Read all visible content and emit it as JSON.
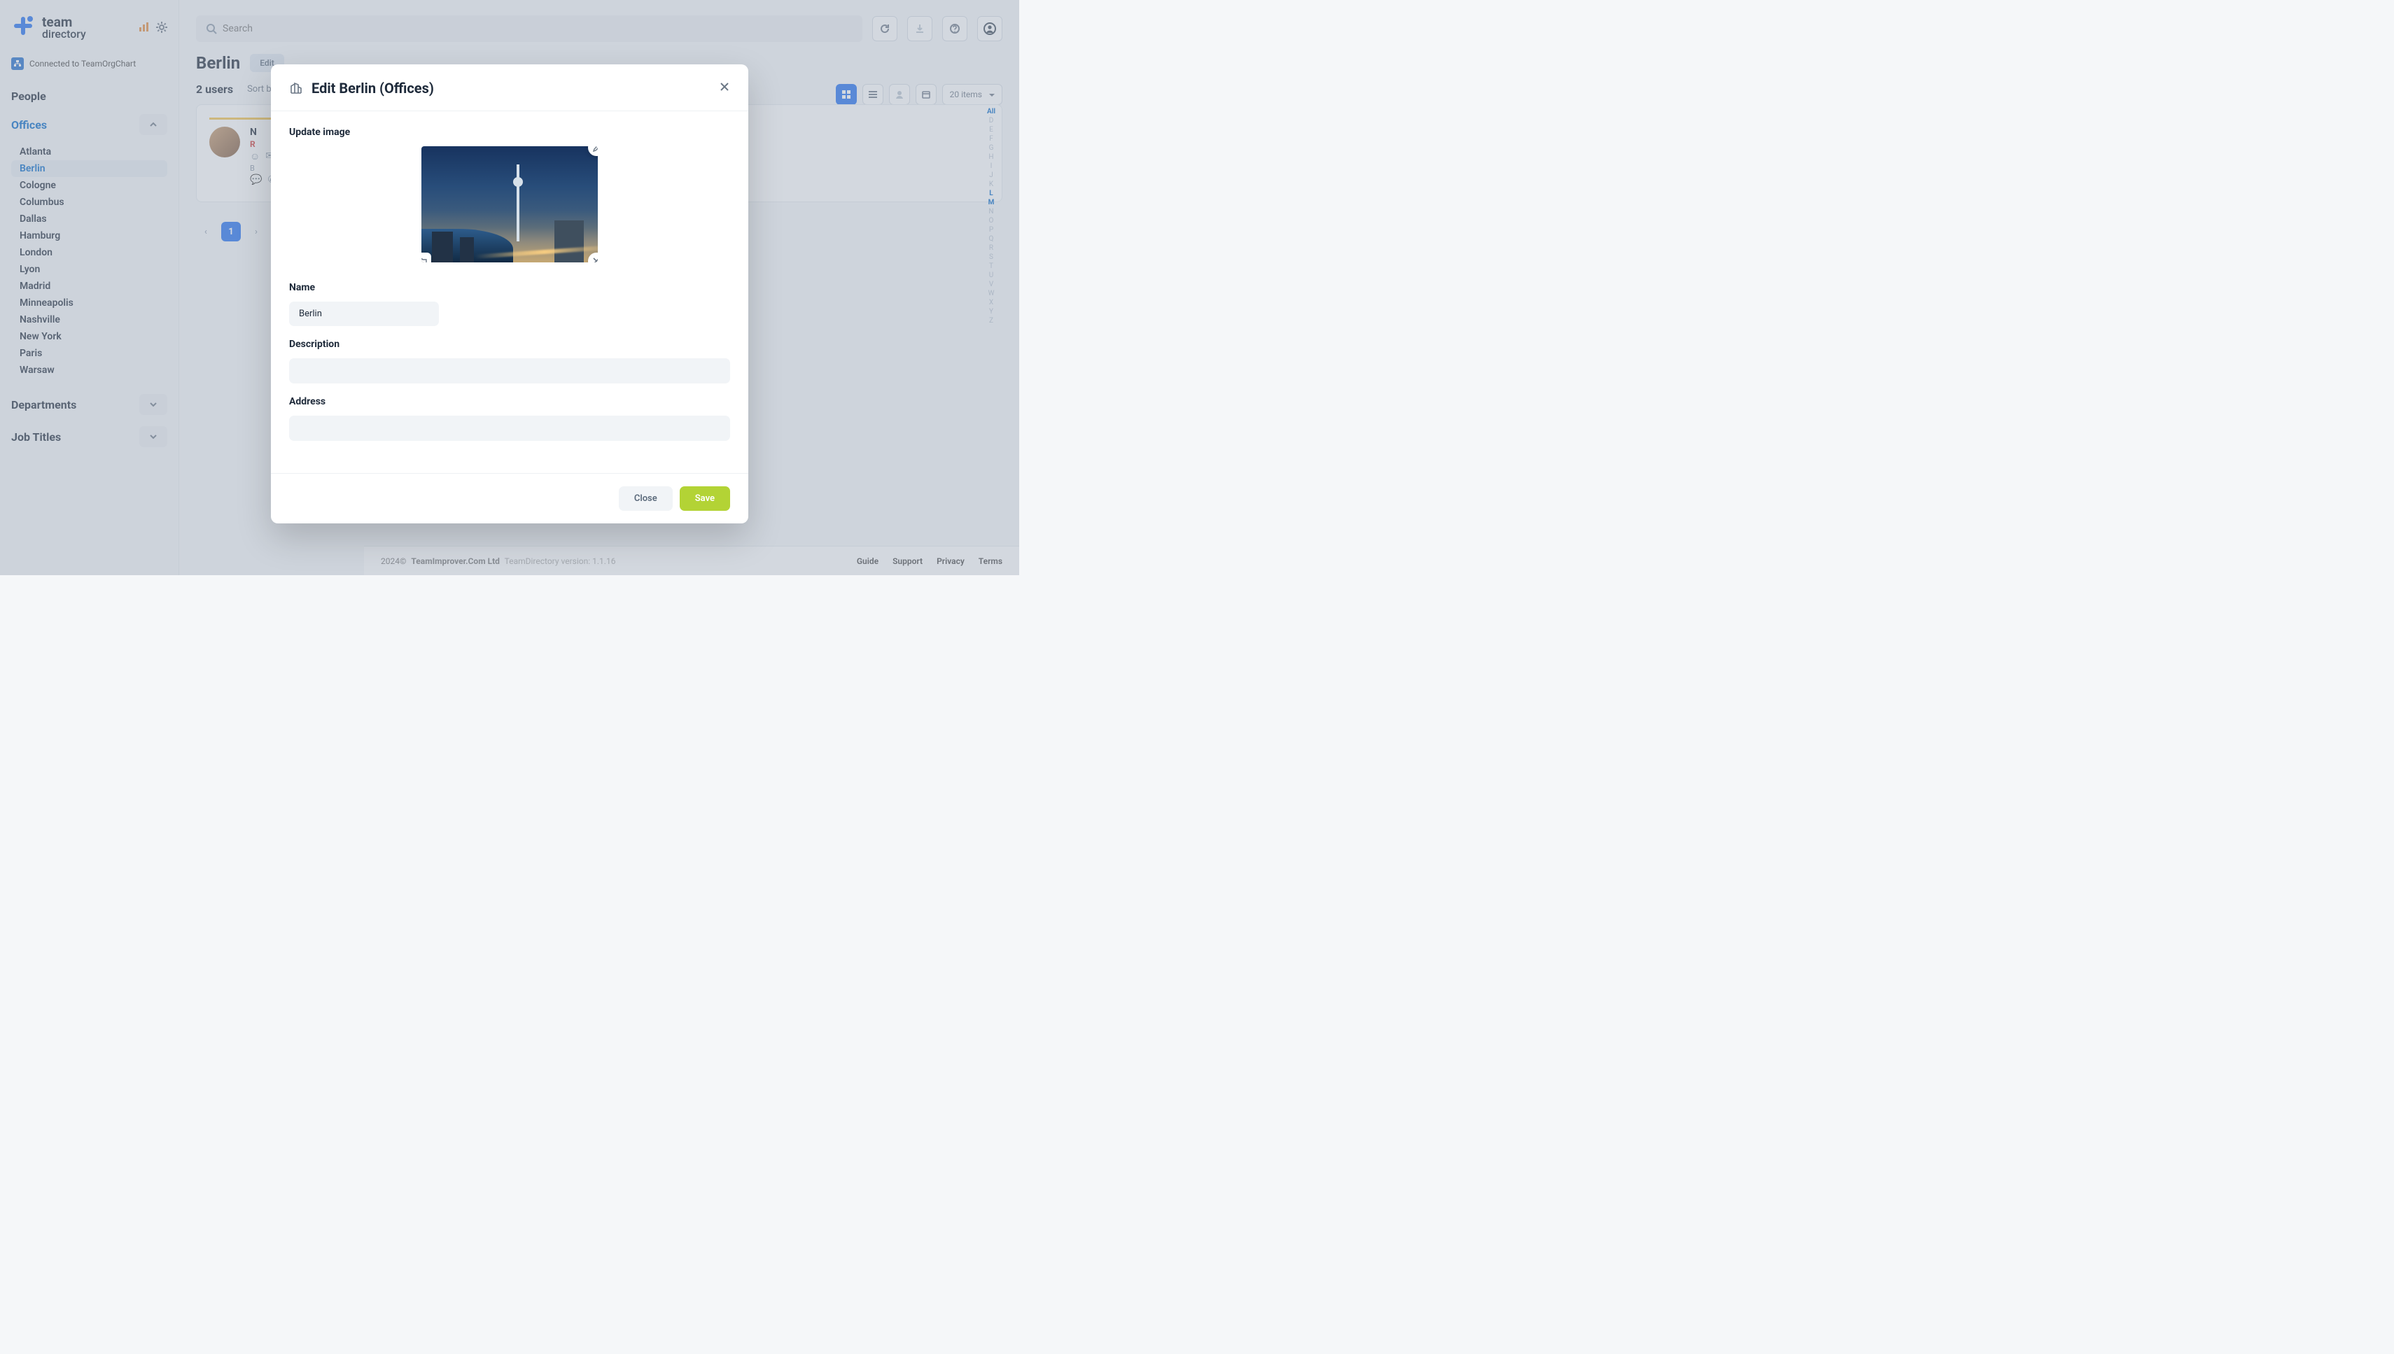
{
  "brand": {
    "line1": "team",
    "line2": "directory"
  },
  "connected": {
    "label": "Connected to TeamOrgChart"
  },
  "sidebar": {
    "people": "People",
    "offices_label": "Offices",
    "departments_label": "Departments",
    "jobtitles_label": "Job Titles",
    "offices": [
      "Atlanta",
      "Berlin",
      "Cologne",
      "Columbus",
      "Dallas",
      "Hamburg",
      "London",
      "Lyon",
      "Madrid",
      "Minneapolis",
      "Nashville",
      "New York",
      "Paris",
      "Warsaw"
    ],
    "active_office_index": 1
  },
  "search": {
    "placeholder": "Search"
  },
  "page": {
    "title": "Berlin",
    "edit_pill": "Edit"
  },
  "subrow": {
    "count": "2 users",
    "sortby": "Sort by"
  },
  "view": {
    "items_label": "20 items"
  },
  "card": {
    "name_initial": "N",
    "role_initial": "R",
    "loc_initial": "B"
  },
  "alpha": {
    "all": "All",
    "letters": [
      "D",
      "E",
      "F",
      "G",
      "H",
      "I",
      "J",
      "K",
      "L",
      "M",
      "N",
      "O",
      "P",
      "Q",
      "R",
      "S",
      "T",
      "U",
      "V",
      "W",
      "X",
      "Y",
      "Z"
    ],
    "active": [
      "L",
      "M"
    ]
  },
  "pager": {
    "page": "1"
  },
  "footer": {
    "copyright": "2024©",
    "company": "TeamImprover.Com Ltd",
    "version": "TeamDirectory version: 1.1.16",
    "links": [
      "Guide",
      "Support",
      "Privacy",
      "Terms"
    ]
  },
  "modal": {
    "title": "Edit Berlin (Offices)",
    "update_image": "Update image",
    "name_label": "Name",
    "name_value": "Berlin",
    "desc_label": "Description",
    "desc_value": "",
    "addr_label": "Address",
    "addr_value": "",
    "close": "Close",
    "save": "Save"
  }
}
